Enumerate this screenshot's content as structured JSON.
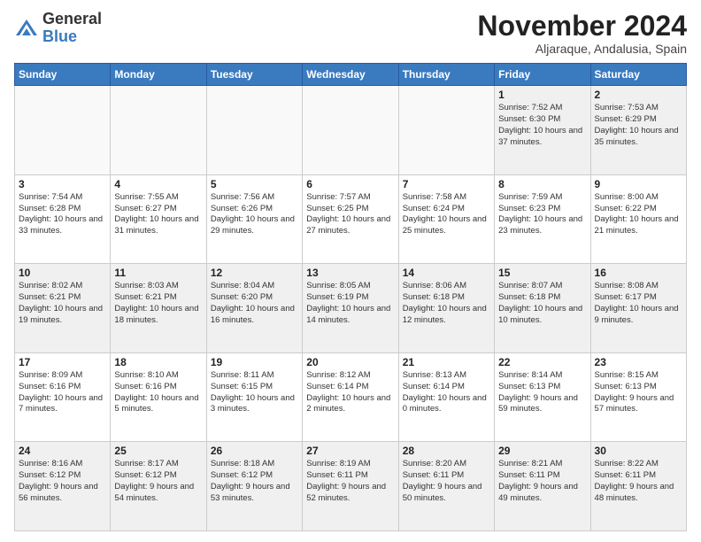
{
  "logo": {
    "general": "General",
    "blue": "Blue"
  },
  "header": {
    "month": "November 2024",
    "location": "Aljaraque, Andalusia, Spain"
  },
  "weekdays": [
    "Sunday",
    "Monday",
    "Tuesday",
    "Wednesday",
    "Thursday",
    "Friday",
    "Saturday"
  ],
  "weeks": [
    [
      {
        "day": "",
        "info": ""
      },
      {
        "day": "",
        "info": ""
      },
      {
        "day": "",
        "info": ""
      },
      {
        "day": "",
        "info": ""
      },
      {
        "day": "",
        "info": ""
      },
      {
        "day": "1",
        "info": "Sunrise: 7:52 AM\nSunset: 6:30 PM\nDaylight: 10 hours and 37 minutes."
      },
      {
        "day": "2",
        "info": "Sunrise: 7:53 AM\nSunset: 6:29 PM\nDaylight: 10 hours and 35 minutes."
      }
    ],
    [
      {
        "day": "3",
        "info": "Sunrise: 7:54 AM\nSunset: 6:28 PM\nDaylight: 10 hours and 33 minutes."
      },
      {
        "day": "4",
        "info": "Sunrise: 7:55 AM\nSunset: 6:27 PM\nDaylight: 10 hours and 31 minutes."
      },
      {
        "day": "5",
        "info": "Sunrise: 7:56 AM\nSunset: 6:26 PM\nDaylight: 10 hours and 29 minutes."
      },
      {
        "day": "6",
        "info": "Sunrise: 7:57 AM\nSunset: 6:25 PM\nDaylight: 10 hours and 27 minutes."
      },
      {
        "day": "7",
        "info": "Sunrise: 7:58 AM\nSunset: 6:24 PM\nDaylight: 10 hours and 25 minutes."
      },
      {
        "day": "8",
        "info": "Sunrise: 7:59 AM\nSunset: 6:23 PM\nDaylight: 10 hours and 23 minutes."
      },
      {
        "day": "9",
        "info": "Sunrise: 8:00 AM\nSunset: 6:22 PM\nDaylight: 10 hours and 21 minutes."
      }
    ],
    [
      {
        "day": "10",
        "info": "Sunrise: 8:02 AM\nSunset: 6:21 PM\nDaylight: 10 hours and 19 minutes."
      },
      {
        "day": "11",
        "info": "Sunrise: 8:03 AM\nSunset: 6:21 PM\nDaylight: 10 hours and 18 minutes."
      },
      {
        "day": "12",
        "info": "Sunrise: 8:04 AM\nSunset: 6:20 PM\nDaylight: 10 hours and 16 minutes."
      },
      {
        "day": "13",
        "info": "Sunrise: 8:05 AM\nSunset: 6:19 PM\nDaylight: 10 hours and 14 minutes."
      },
      {
        "day": "14",
        "info": "Sunrise: 8:06 AM\nSunset: 6:18 PM\nDaylight: 10 hours and 12 minutes."
      },
      {
        "day": "15",
        "info": "Sunrise: 8:07 AM\nSunset: 6:18 PM\nDaylight: 10 hours and 10 minutes."
      },
      {
        "day": "16",
        "info": "Sunrise: 8:08 AM\nSunset: 6:17 PM\nDaylight: 10 hours and 9 minutes."
      }
    ],
    [
      {
        "day": "17",
        "info": "Sunrise: 8:09 AM\nSunset: 6:16 PM\nDaylight: 10 hours and 7 minutes."
      },
      {
        "day": "18",
        "info": "Sunrise: 8:10 AM\nSunset: 6:16 PM\nDaylight: 10 hours and 5 minutes."
      },
      {
        "day": "19",
        "info": "Sunrise: 8:11 AM\nSunset: 6:15 PM\nDaylight: 10 hours and 3 minutes."
      },
      {
        "day": "20",
        "info": "Sunrise: 8:12 AM\nSunset: 6:14 PM\nDaylight: 10 hours and 2 minutes."
      },
      {
        "day": "21",
        "info": "Sunrise: 8:13 AM\nSunset: 6:14 PM\nDaylight: 10 hours and 0 minutes."
      },
      {
        "day": "22",
        "info": "Sunrise: 8:14 AM\nSunset: 6:13 PM\nDaylight: 9 hours and 59 minutes."
      },
      {
        "day": "23",
        "info": "Sunrise: 8:15 AM\nSunset: 6:13 PM\nDaylight: 9 hours and 57 minutes."
      }
    ],
    [
      {
        "day": "24",
        "info": "Sunrise: 8:16 AM\nSunset: 6:12 PM\nDaylight: 9 hours and 56 minutes."
      },
      {
        "day": "25",
        "info": "Sunrise: 8:17 AM\nSunset: 6:12 PM\nDaylight: 9 hours and 54 minutes."
      },
      {
        "day": "26",
        "info": "Sunrise: 8:18 AM\nSunset: 6:12 PM\nDaylight: 9 hours and 53 minutes."
      },
      {
        "day": "27",
        "info": "Sunrise: 8:19 AM\nSunset: 6:11 PM\nDaylight: 9 hours and 52 minutes."
      },
      {
        "day": "28",
        "info": "Sunrise: 8:20 AM\nSunset: 6:11 PM\nDaylight: 9 hours and 50 minutes."
      },
      {
        "day": "29",
        "info": "Sunrise: 8:21 AM\nSunset: 6:11 PM\nDaylight: 9 hours and 49 minutes."
      },
      {
        "day": "30",
        "info": "Sunrise: 8:22 AM\nSunset: 6:11 PM\nDaylight: 9 hours and 48 minutes."
      }
    ]
  ]
}
